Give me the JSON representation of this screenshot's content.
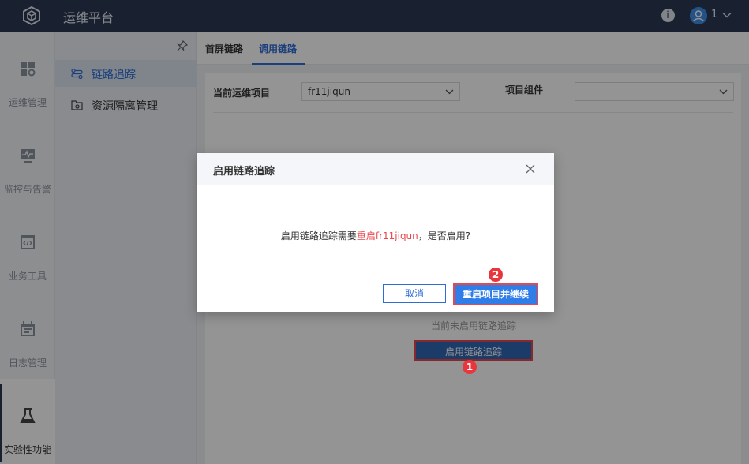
{
  "header": {
    "app_title": "运维平台",
    "user_name": "1"
  },
  "rail": {
    "items": [
      {
        "label": "运维管理"
      },
      {
        "label": "监控与告警"
      },
      {
        "label": "业务工具"
      },
      {
        "label": "日志管理"
      },
      {
        "label": "实验性功能"
      }
    ]
  },
  "subnav": {
    "items": [
      {
        "label": "链路追踪"
      },
      {
        "label": "资源隔离管理"
      }
    ]
  },
  "tabs": [
    {
      "label": "首屏链路"
    },
    {
      "label": "调用链路"
    }
  ],
  "filters": {
    "project_label": "当前运维项目",
    "project_value": "fr11jiqun",
    "component_label": "项目组件",
    "component_value": ""
  },
  "main": {
    "empty_text": "当前未启用链路追踪",
    "enable_button": "启用链路追踪"
  },
  "dialog": {
    "title": "启用链路追踪",
    "message_prefix": "启用链路追踪需要",
    "message_highlight": "重启fr11jiqun",
    "message_suffix": "，是否启用?",
    "cancel_label": "取消",
    "confirm_label": "重启项目并继续"
  },
  "annotations": {
    "step1": "1",
    "step2": "2"
  },
  "colors": {
    "topbar": "#2c3a55",
    "accent": "#2f6dd6",
    "highlight_red": "#e8474c"
  }
}
